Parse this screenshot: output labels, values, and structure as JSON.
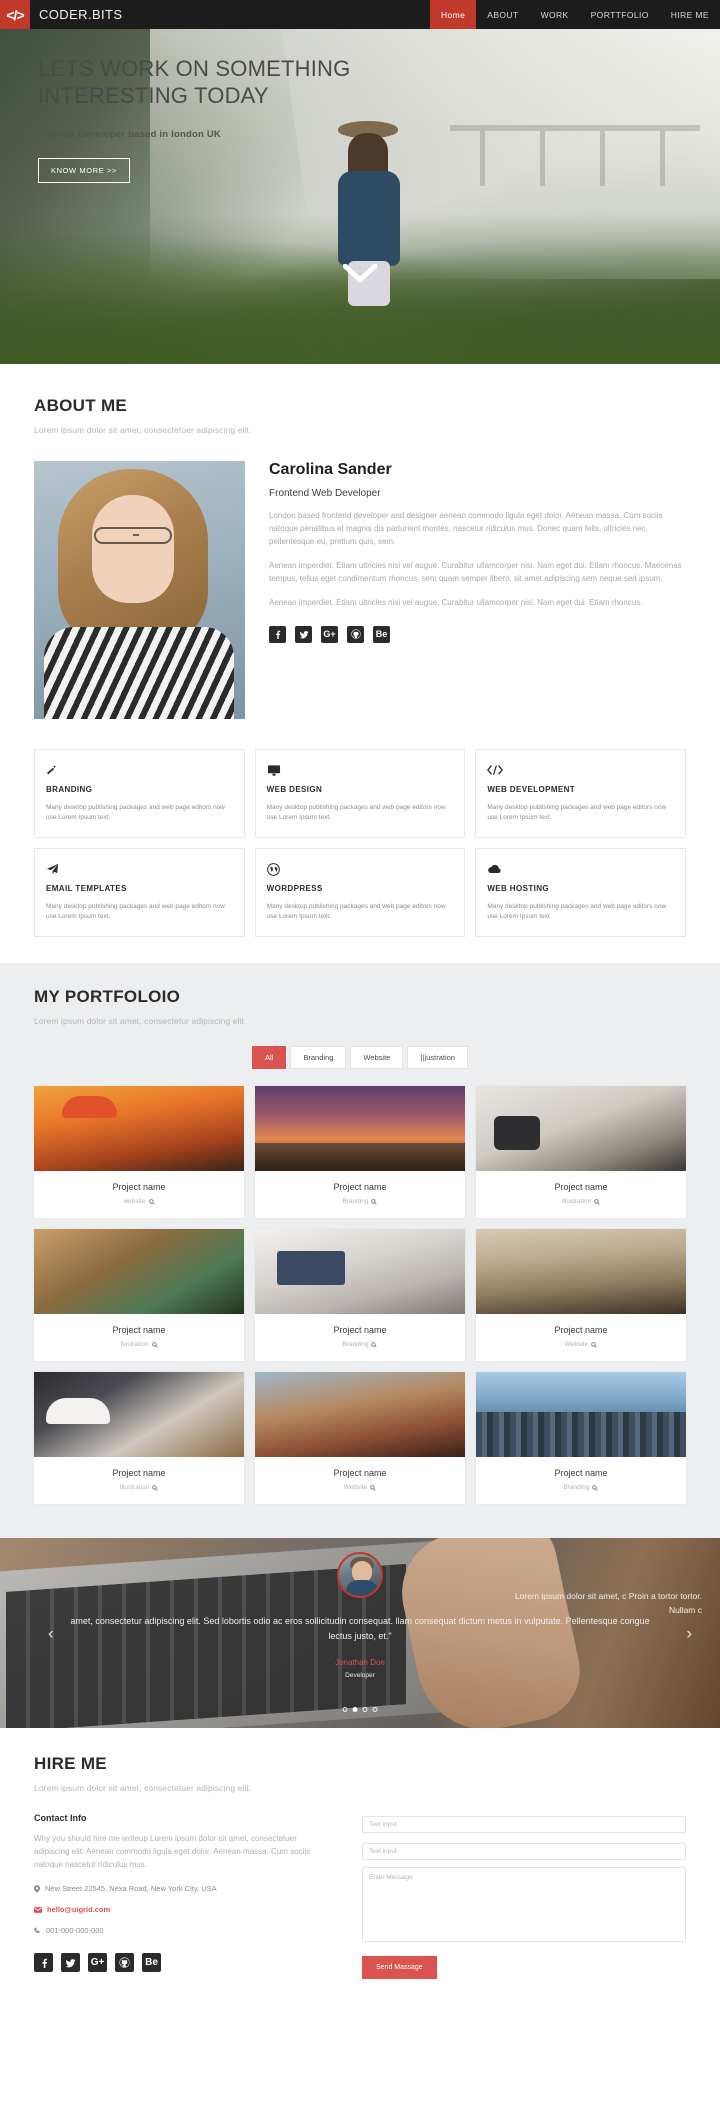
{
  "navbar": {
    "brand_icon": "code-brackets-icon",
    "brand": "CODER.BITS",
    "links": [
      {
        "label": "Home",
        "active": true
      },
      {
        "label": "ABOUT",
        "active": false
      },
      {
        "label": "WORK",
        "active": false
      },
      {
        "label": "PORTTFOLIO",
        "active": false
      },
      {
        "label": "HIRE ME",
        "active": false
      }
    ]
  },
  "hero": {
    "title": "LETS WORK ON SOMETHING INTERESTING TODAY",
    "subtitle": "Fronted Developer based in london UK",
    "button": "KNOW MORE >>",
    "scroll_icon": "chevron-down-icon"
  },
  "about": {
    "title": "ABOUT ME",
    "subtitle": "Lorem ipsum dolor sit amet, consectetuer adipiscing elit.",
    "name": "Carolina Sander",
    "role": "Frontend Web Developer",
    "paragraphs": [
      "London based frontend developer and designer aenean commodo ligula eget dolor. Aenean massa. Cum sociis natoque penatibus et magnis dis parturient montes, nascetur ridiculus mus. Donec quam felis, ultricies nec, pellentesque eu, pretium quis, sem.",
      "Aenean imperdiet. Etiam ultricies nisi vel augue. Curabitur ullamcorper nisi. Nam eget dui. Etiam rhoncus. Maecenas tempus, tellus eget condimentum rhoncus, sem quam semper libero, sit amet adipiscing sem neque sed ipsum.",
      "Aenean imperdiet. Etiam ultricies nisi vel augue. Curabitur ullamcorper nisi. Nam eget dui. Etiam rhoncus."
    ],
    "socials": [
      "facebook-icon",
      "twitter-icon",
      "google-plus-icon",
      "github-icon",
      "behance-icon"
    ]
  },
  "services": [
    {
      "icon": "magic-wand-icon",
      "name": "BRANDING",
      "desc": "Many desktop publishing packages and web page editors now use Lorem Ipsum text."
    },
    {
      "icon": "monitor-icon",
      "name": "WEB DESIGN",
      "desc": "Many desktop publishing packages and web page editors now use Lorem Ipsum text."
    },
    {
      "icon": "code-brackets-icon",
      "name": "WEB DEVELOPMENT",
      "desc": "Many desktop publishing packages and web page editors now use Lorem Ipsum text."
    },
    {
      "icon": "paper-plane-icon",
      "name": "EMAIL TEMPLATES",
      "desc": "Many desktop publishing packages and web page editors now use Lorem Ipsum text."
    },
    {
      "icon": "wordpress-icon",
      "name": "WORDPRESS",
      "desc": "Many desktop publishing packages and web page editors now use Lorem Ipsum text."
    },
    {
      "icon": "cloud-icon",
      "name": "WEB HOSTING",
      "desc": "Many desktop publishing packages and web page editors now use Lorem Ipsum text."
    }
  ],
  "portfolio": {
    "title": "MY PORTFOLOIO",
    "subtitle": "Lorem ipsum dolor sit amet, consectetur adipiscing elit",
    "filters": [
      {
        "label": "All",
        "active": true
      },
      {
        "label": "Branding",
        "active": false
      },
      {
        "label": "Website",
        "active": false
      },
      {
        "label": "|||ustration",
        "active": false
      }
    ],
    "items": [
      {
        "name": "Project name",
        "category": "website",
        "thumb": "img-paraglide"
      },
      {
        "name": "Project name",
        "category": "Branding",
        "thumb": "img-palms"
      },
      {
        "name": "Project name",
        "category": "Illustration",
        "thumb": "img-office"
      },
      {
        "name": "Project name",
        "category": "|lustration",
        "thumb": "img-interior"
      },
      {
        "name": "Project name",
        "category": "Branding",
        "thumb": "img-laptop"
      },
      {
        "name": "Project name",
        "category": "Website",
        "thumb": "img-street"
      },
      {
        "name": "Project name",
        "category": "Illustration",
        "thumb": "img-device"
      },
      {
        "name": "Project name",
        "category": "Website",
        "thumb": "img-brick"
      },
      {
        "name": "Project name",
        "category": "Branding",
        "thumb": "img-city"
      }
    ],
    "zoom_icon": "search-icon"
  },
  "testimonial": {
    "quote": "amet, consectetur adipiscing elit. Sed lobortis odio ac eros sollicitudin consequat. llam consequat dictum metus in vulputate. Pellentesque congue lectus justo, et.\"",
    "author": "Jonathan Doe",
    "role": "Developer",
    "side_text": "Lorem ipsum dolor sit amet, c Proin a tortor tortor. Nullam c",
    "prev_icon": "chevron-left-icon",
    "next_icon": "chevron-right-icon",
    "dots": [
      {
        "active": false
      },
      {
        "active": true
      },
      {
        "active": false
      },
      {
        "active": false
      }
    ]
  },
  "hire": {
    "title": "HIRE ME",
    "subtitle": "Lorem ipsum dolor sit amet, consectetuer adipiscing elit.",
    "contact_heading": "Contact Info",
    "contact_text": "Why you should hire me writeup Lorem ipsum dolor sit amet, consectetuer adipiscing elit. Aenean commodo ligula eget dolor. Aenean massa. Cum sociis natoque nascetur ridiculus mus.",
    "address": "New Street 22545, Nexa Road, New York City, USA",
    "address_icon": "map-pin-icon",
    "email": "hello@uigrid.com",
    "email_icon": "envelope-icon",
    "phone": "001-000-000-000",
    "phone_icon": "phone-icon",
    "form": {
      "input1_placeholder": "Text input",
      "input1_value": "",
      "input2_placeholder": "Text input",
      "input2_value": "",
      "message_placeholder": "Enter Message",
      "message_value": "",
      "submit": "Send Massage"
    },
    "socials": [
      "facebook-icon",
      "twitter-icon",
      "google-plus-icon",
      "github-icon",
      "behance-icon"
    ]
  },
  "colors": {
    "accent": "#c0392b",
    "accent_light": "#d9534f",
    "dark": "#1c1c1c",
    "portfolio_bg": "#eceef0"
  }
}
